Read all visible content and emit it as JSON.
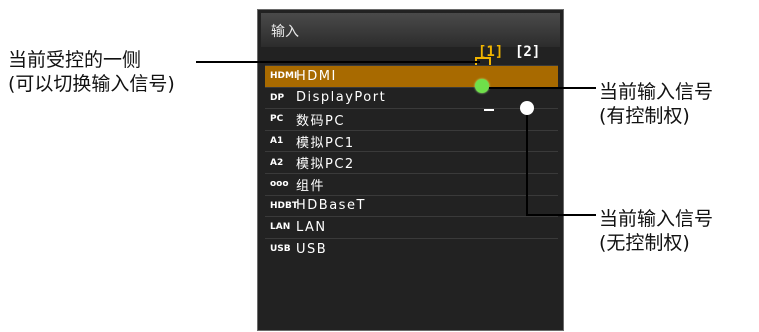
{
  "callouts": {
    "left_line1": "当前受控的一侧",
    "left_line2": "(可以切换输入信号)",
    "right1_line1": "当前输入信号",
    "right1_line2": "(有控制权)",
    "right2_line1": "当前输入信号",
    "right2_line2": "(无控制权)"
  },
  "menu": {
    "title": "输入",
    "columns": [
      "[1]",
      "[2]"
    ],
    "items": [
      {
        "icon": "HDMI",
        "label": "HDMI",
        "selected": true
      },
      {
        "icon": "DP",
        "label": "DisplayPort"
      },
      {
        "icon": "PC",
        "label": "数码PC"
      },
      {
        "icon": "A1",
        "label": "模拟PC1"
      },
      {
        "icon": "A2",
        "label": "模拟PC2"
      },
      {
        "icon": "ooo",
        "label": "组件"
      },
      {
        "icon": "HDBT",
        "label": "HDBaseT"
      },
      {
        "icon": "LAN",
        "label": "LAN"
      },
      {
        "icon": "USB",
        "label": "USB"
      }
    ]
  },
  "colors": {
    "selected_row": "#a86a00",
    "active_column": "#f0b400",
    "controlled_indicator": "#6fe04a",
    "uncontrolled_indicator": "#ffffff"
  }
}
